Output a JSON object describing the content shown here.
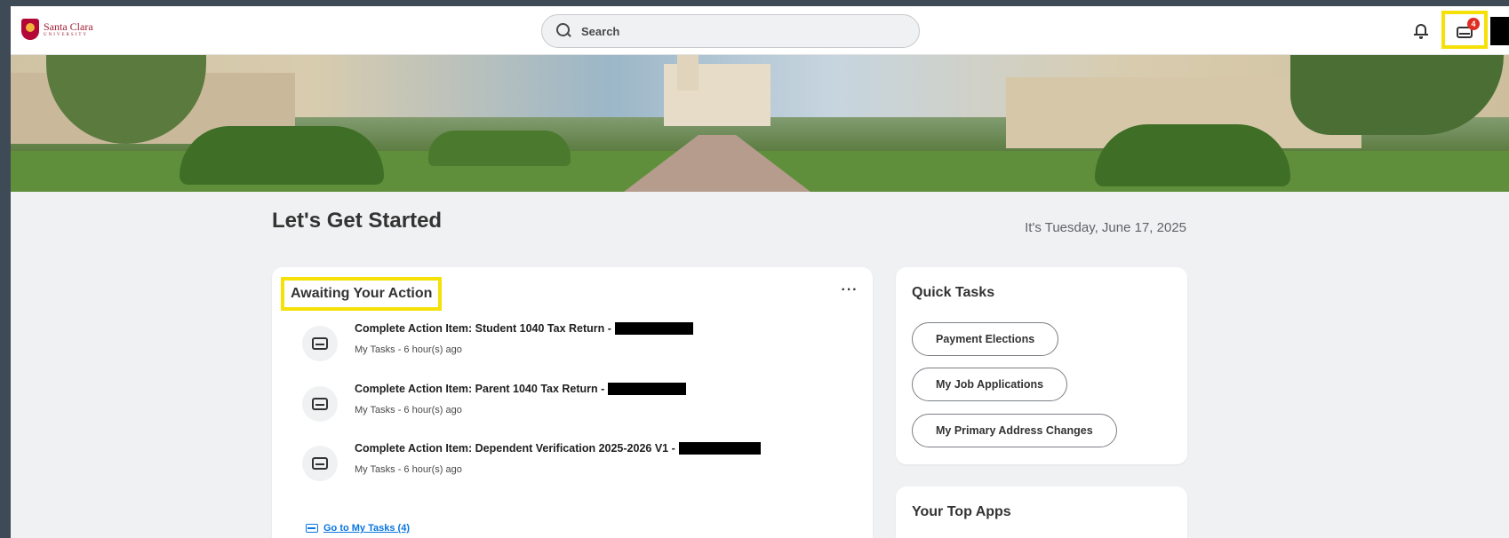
{
  "header": {
    "logo_line1": "Santa Clara",
    "logo_line2": "UNIVERSITY",
    "search_placeholder": "Search",
    "inbox_badge": "4"
  },
  "main": {
    "title": "Let's Get Started",
    "date": "It's Tuesday, June 17, 2025"
  },
  "awaiting": {
    "title": "Awaiting Your Action",
    "more_label": "···",
    "tasks": [
      {
        "title": "Complete Action Item: Student 1040 Tax Return -",
        "sub": "My Tasks - 6 hour(s) ago"
      },
      {
        "title": "Complete Action Item: Parent 1040 Tax Return -",
        "sub": "My Tasks - 6 hour(s) ago"
      },
      {
        "title": "Complete Action Item: Dependent Verification 2025-2026 V1 -",
        "sub": "My Tasks - 6 hour(s) ago"
      }
    ],
    "go_link": "Go to My Tasks (4)"
  },
  "quick_tasks": {
    "title": "Quick Tasks",
    "items": [
      "Payment Elections",
      "My Job Applications",
      "My Primary Address Changes"
    ]
  },
  "top_apps": {
    "title": "Your Top Apps"
  },
  "colors": {
    "highlight": "#f5e107",
    "badge": "#de2e21",
    "link": "#0875e1"
  }
}
